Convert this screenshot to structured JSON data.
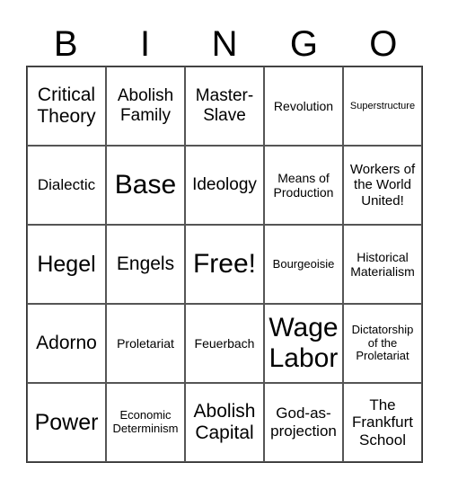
{
  "header": [
    "B",
    "I",
    "N",
    "G",
    "O"
  ],
  "cells": [
    "Critical Theory",
    "Abolish Family",
    "Master-Slave",
    "Revolution",
    "Superstructure",
    "Dialectic",
    "Base",
    "Ideology",
    "Means of Production",
    "Workers of the World United!",
    "Hegel",
    "Engels",
    "Free!",
    "Bourgeoisie",
    "Historical Materialism",
    "Adorno",
    "Proletariat",
    "Feuerbach",
    "Wage Labor",
    "Dictatorship of the Proletariat",
    "Power",
    "Economic Determinism",
    "Abolish Capital",
    "God-as-projection",
    "The Frankfurt School"
  ]
}
